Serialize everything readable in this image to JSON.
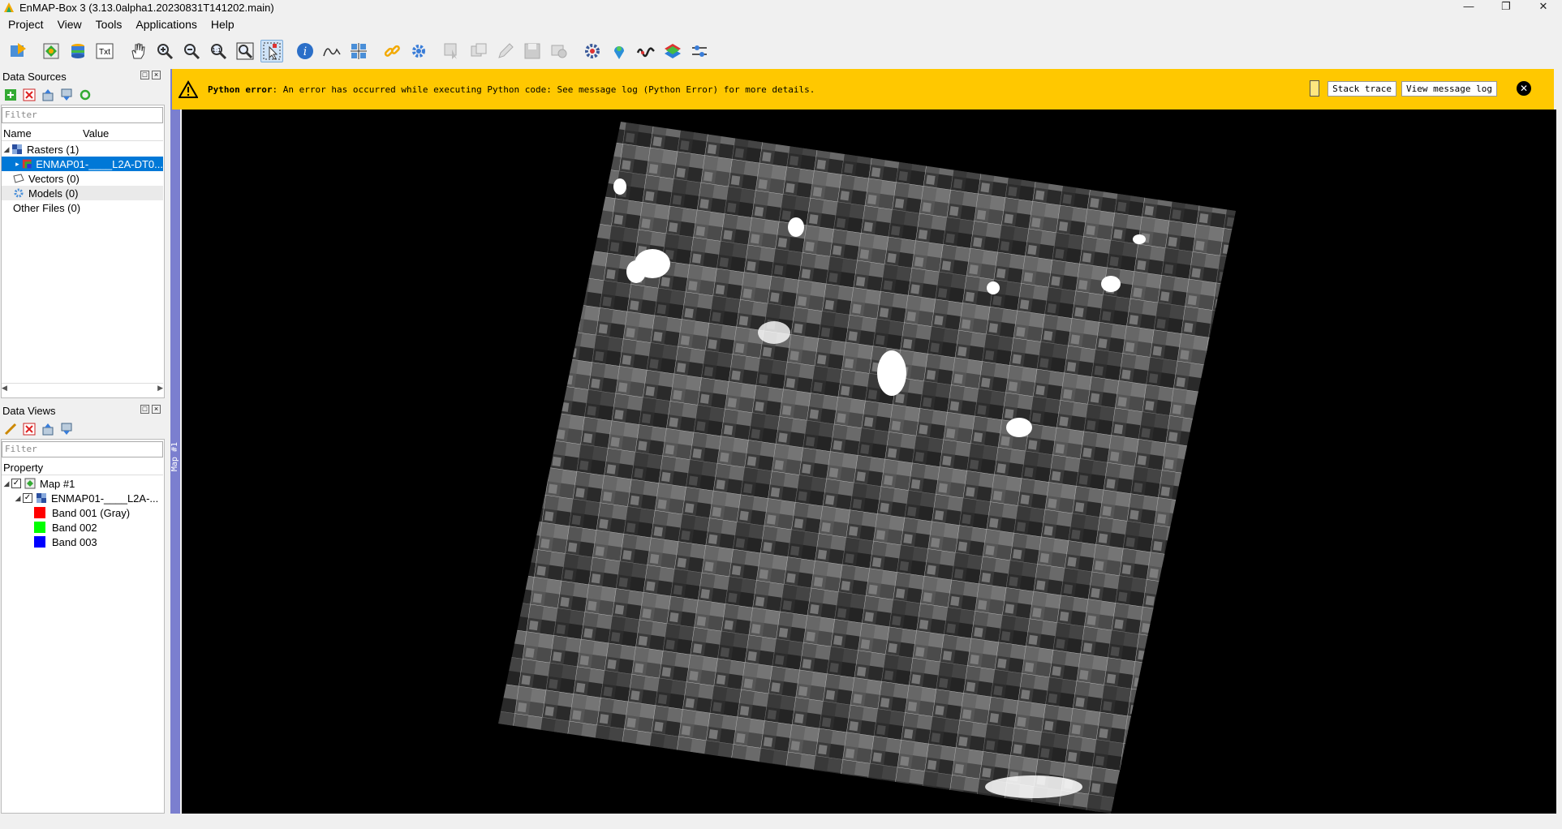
{
  "window": {
    "title": "EnMAP-Box 3 (3.13.0alpha1.20230831T141202.main)"
  },
  "menu": [
    "Project",
    "View",
    "Tools",
    "Applications",
    "Help"
  ],
  "toolbar": {
    "icons": [
      "project-icon",
      "add-raster-icon",
      "add-database-icon",
      "txt-icon",
      "pan-icon",
      "zoom-in-icon",
      "zoom-out-icon",
      "zoom-native-icon",
      "zoom-full-icon",
      "select-icon",
      "identify-icon",
      "spectral-profile-icon",
      "crosshair-icon",
      "link-icon",
      "settings-icon",
      "select-feature-icon",
      "digitize-icon",
      "edit-icon",
      "save-icon",
      "record-icon",
      "processing-icon",
      "locate-icon",
      "wave-icon",
      "layers-icon",
      "tools-icon"
    ],
    "txt_label": "Txt"
  },
  "data_sources": {
    "title": "Data Sources",
    "filter_placeholder": "Filter",
    "col_name": "Name",
    "col_value": "Value",
    "items": [
      {
        "label": "Rasters (1)"
      },
      {
        "label": "ENMAP01-____L2A-DT0..."
      },
      {
        "label": "Vectors (0)"
      },
      {
        "label": "Models (0)"
      },
      {
        "label": "Other Files (0)"
      }
    ]
  },
  "data_views": {
    "title": "Data Views",
    "filter_placeholder": "Filter",
    "col_property": "Property",
    "items": [
      {
        "label": "Map #1"
      },
      {
        "label": "ENMAP01-____L2A-..."
      },
      {
        "label": "Band 001 (Gray)",
        "color": "#ff0000"
      },
      {
        "label": "Band 002",
        "color": "#00ff00"
      },
      {
        "label": "Band 003",
        "color": "#0000ff"
      }
    ]
  },
  "map": {
    "tab_label": "Map #1"
  },
  "error": {
    "label": "Python error",
    "message": ": An error has occurred while executing Python code: See message log (Python Error) for more details.",
    "stack_trace": "Stack trace",
    "view_log": "View message log",
    "bar_color": "#ffc800"
  }
}
